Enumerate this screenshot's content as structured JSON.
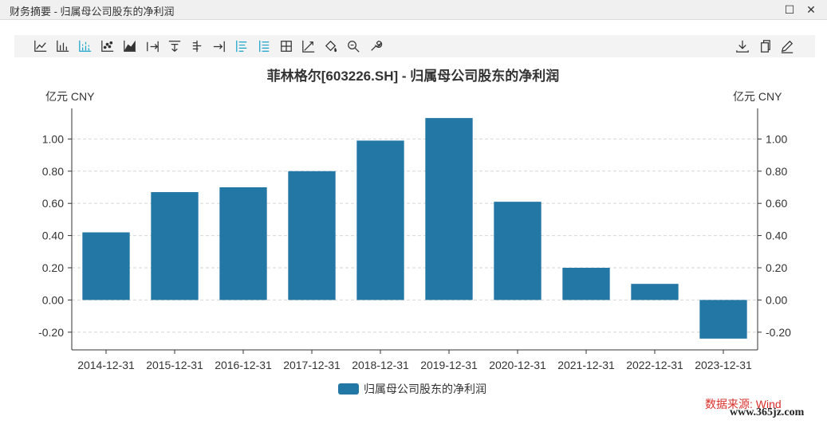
{
  "window": {
    "title": "财务摘要 - 归属母公司股东的净利润",
    "maximize_label": "☐",
    "close_label": "✕"
  },
  "toolbar": {
    "left_icons": [
      "line-chart-icon",
      "bar-chart-icon",
      "stacked-bar-icon",
      "scatter-icon",
      "area-chart-icon",
      "align-right-icon",
      "align-top-icon",
      "align-center-icon",
      "align-end-icon",
      "list-left-icon",
      "list-center-icon",
      "grid-icon",
      "trend-icon",
      "fill-icon",
      "zoom-icon",
      "settings-icon"
    ],
    "active_icons": [
      "stacked-bar-icon",
      "list-left-icon",
      "list-center-icon"
    ],
    "right_icons": [
      "download-icon",
      "copy-icon",
      "edit-icon"
    ],
    "accent": "#1aa3c9"
  },
  "chart_data": {
    "type": "bar",
    "title": "菲林格尔[603226.SH] - 归属母公司股东的净利润",
    "unit_left": "亿元  CNY",
    "unit_right": "亿元  CNY",
    "categories": [
      "2014-12-31",
      "2015-12-31",
      "2016-12-31",
      "2017-12-31",
      "2018-12-31",
      "2019-12-31",
      "2020-12-31",
      "2021-12-31",
      "2022-12-31",
      "2023-12-31"
    ],
    "series": [
      {
        "name": "归属母公司股东的净利润",
        "color": "#2277a5",
        "values": [
          0.42,
          0.67,
          0.7,
          0.8,
          0.99,
          1.13,
          0.61,
          0.2,
          0.1,
          -0.24
        ]
      }
    ],
    "ylim": [
      -0.31,
      1.19
    ],
    "yticks": [
      -0.2,
      0.0,
      0.2,
      0.4,
      0.6,
      0.8,
      1.0
    ],
    "ytick_labels": [
      "-0.20",
      "0.00",
      "0.20",
      "0.40",
      "0.60",
      "0.80",
      "1.00"
    ],
    "grid": true,
    "legend_position": "bottom-center"
  },
  "footer": {
    "source": "数据来源: Wind",
    "site": "www.365jz.com"
  }
}
